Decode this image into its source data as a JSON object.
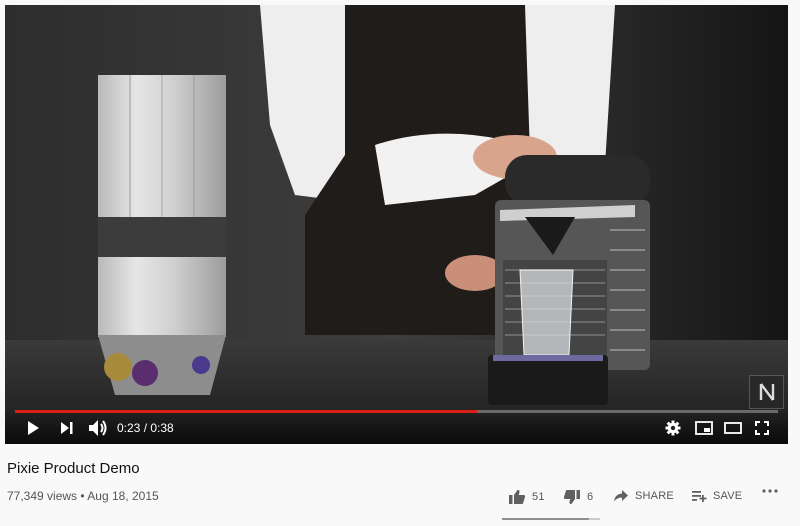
{
  "video": {
    "current_time": "0:23",
    "duration": "0:38",
    "progress_fraction": 0.605
  },
  "title": "Pixie Product Demo",
  "views": "77,349 views",
  "date": "Aug 18, 2015",
  "actions": {
    "like_count": "51",
    "dislike_count": "6",
    "share_label": "SHARE",
    "save_label": "SAVE"
  },
  "like_ratio": 0.89,
  "colors": {
    "progress": "#e62117",
    "page_bg": "#f9f9f9"
  }
}
